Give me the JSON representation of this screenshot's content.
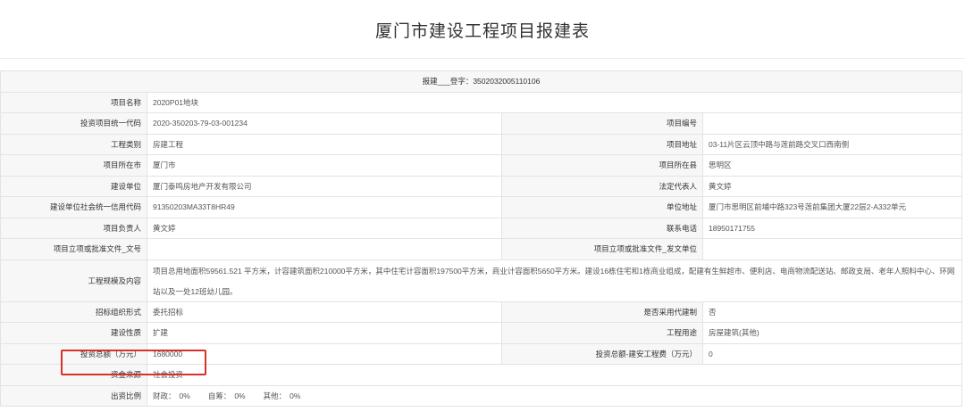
{
  "page": {
    "title": "厦门市建设工程项目报建表"
  },
  "form": {
    "registration": "报建___登字：3502032005110106",
    "rows": [
      {
        "label": "项目名称",
        "value": "2020P01地块"
      },
      {
        "label": "投资项目统一代码",
        "value": "2020-350203-79-03-001234",
        "label2": "项目编号",
        "value2": ""
      },
      {
        "label": "工程类别",
        "value": "房建工程",
        "label2": "项目地址",
        "value2": "03-11片区云顶中路与莲前路交叉口西南侧"
      },
      {
        "label": "项目所在市",
        "value": "厦门市",
        "label2": "项目所在县",
        "value2": "思明区"
      },
      {
        "label": "建设单位",
        "value": "厦门泰鸣房地产开发有限公司",
        "label2": "法定代表人",
        "value2": "黄文婷"
      },
      {
        "label": "建设单位社会统一信用代码",
        "value": "91350203MA33T8HR49",
        "label2": "单位地址",
        "value2": "厦门市思明区前埔中路323号莲前集团大厦22层2-A332单元"
      },
      {
        "label": "项目负责人",
        "value": "黄文婷",
        "label2": "联系电话",
        "value2": "18950171755"
      },
      {
        "label": "项目立项或批准文件_文号",
        "value": "",
        "label2": "项目立项或批准文件_发文单位",
        "value2": ""
      },
      {
        "label": "工程规模及内容",
        "value": "项目总用地面积59561.521 平方米，计容建筑面积210000平方米，其中住宅计容面积197500平方米，商业计容面积5650平方米。建设16栋住宅和1栋商业组成，配建有生鲜超市、便利店、电商物流配送站、邮政支局、老年人照料中心、环网站以及一处12班幼儿园。"
      },
      {
        "label": "招标组织形式",
        "value": "委托招标",
        "label2": "是否采用代建制",
        "value2": "否"
      },
      {
        "label": "建设性质",
        "value": "扩建",
        "label2": "工程用途",
        "value2": "房屋建筑(其他)"
      },
      {
        "label": "投资总额（万元）",
        "value": "1680000",
        "label2": "投资总额-建安工程费（万元）",
        "value2": "0"
      },
      {
        "label": "资金来源",
        "value": "社会投资"
      },
      {
        "label": "出资比例",
        "ratio": [
          {
            "name": "财政：",
            "value": "0%"
          },
          {
            "name": "自筹：",
            "value": "0%"
          },
          {
            "name": "其他：",
            "value": "0%"
          }
        ]
      }
    ]
  },
  "colors": {
    "highlight": "#d9302a",
    "label_bg": "#f7f7f7",
    "border": "#e3e3e3"
  }
}
